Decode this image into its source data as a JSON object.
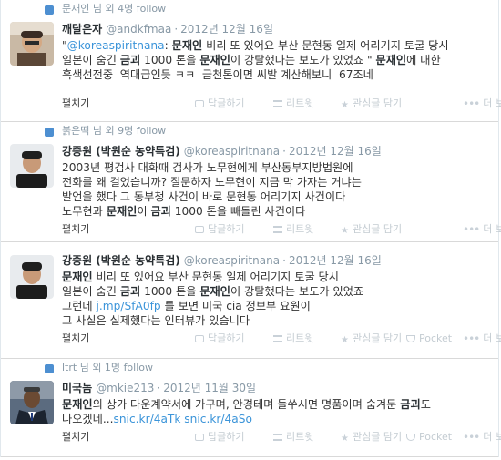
{
  "tweets": [
    {
      "context": {
        "prefix": "문재인 님 외 4명",
        "follow": "follow"
      },
      "name": "깨달은자",
      "handle": "@andkfmaa",
      "sep": "·",
      "time": "2012년 12월 16일",
      "lines": [
        [
          {
            "t": "\""
          },
          {
            "t": "@koreaspiritnana",
            "c": "mention"
          },
          {
            "t": ": "
          },
          {
            "t": "문재인",
            "b": 1
          },
          {
            "t": " 비리 또 있어요 부산 문현동 일제 어리기지 토굴 당시"
          }
        ],
        [
          {
            "t": "일본이 숨긴 "
          },
          {
            "t": "금괴",
            "b": 1
          },
          {
            "t": " 1000 톤을 "
          },
          {
            "t": "문재인",
            "b": 1
          },
          {
            "t": "이 강탈했다는 보도가 있었죠 \" "
          },
          {
            "t": "문재인",
            "b": 1
          },
          {
            "t": "에 대한"
          }
        ],
        [
          {
            "t": "흑색선전중  역대급인듯 ㅋㅋ  금천톤이면 씨발 계산해보니  67조네"
          }
        ]
      ],
      "actions": {
        "expand": "펼치기",
        "reply": "답글하기",
        "retweet": "리트윗",
        "fav": "관심글 담기",
        "pocket": "",
        "more": "더 보기"
      }
    },
    {
      "context": {
        "prefix": "붉은떡 님 외 9명",
        "follow": "follow"
      },
      "name": "강종원 (박원순 농약특검)",
      "handle": "@koreaspiritnana",
      "sep": "·",
      "time": "2012년 12월 16일",
      "lines": [
        [
          {
            "t": "2003년 평검사 대화때 검사가 노무현에게 부산동부지방법원에"
          }
        ],
        [
          {
            "t": "전화를 왜 걸었습니까? 질문하자 노무현이 지금 막 가자는 거냐는"
          }
        ],
        [
          {
            "t": "발언을 했다 그 동부청 사건이 바로 문현동 어리기지 사건이다"
          }
        ],
        [
          {
            "t": "노무현과 "
          },
          {
            "t": "문재인",
            "b": 1
          },
          {
            "t": "이 "
          },
          {
            "t": "금괴",
            "b": 1
          },
          {
            "t": " 1000 톤을 빼돌린 사건이다"
          }
        ]
      ],
      "actions": {
        "expand": "펼치기",
        "reply": "답글하기",
        "retweet": "리트윗",
        "fav": "관심글 담기",
        "pocket": "",
        "more": "더 보기"
      }
    },
    {
      "name": "강종원 (박원순 농약특검)",
      "handle": "@koreaspiritnana",
      "sep": "·",
      "time": "2012년 12월 16일",
      "lines": [
        [
          {
            "t": "문재인",
            "b": 1
          },
          {
            "t": " 비리 또 있어요 부산 문현동 일제 어리기지 토굴 당시"
          }
        ],
        [
          {
            "t": "일본이 숨긴 "
          },
          {
            "t": "금괴",
            "b": 1
          },
          {
            "t": " 1000 톤을 "
          },
          {
            "t": "문재인",
            "b": 1
          },
          {
            "t": "이 강탈했다는 보도가 있었죠"
          }
        ],
        [
          {
            "t": "그런데 "
          },
          {
            "t": "j.mp/SfA0fp",
            "c": "link"
          },
          {
            "t": " 를 보면 미국 cia 정보부 요원이"
          }
        ],
        [
          {
            "t": "그 사실은 실제했다는 인터뷰가 있습니다"
          }
        ]
      ],
      "actions": {
        "expand": "펼치기",
        "reply": "답글하기",
        "retweet": "리트윗",
        "fav": "관심글 담기",
        "pocket": "Pocket",
        "more": "더 보기"
      }
    },
    {
      "context": {
        "prefix": "ltrt 님 외 1명",
        "follow": "follow"
      },
      "name": "미국놈",
      "handle": "@mkie213",
      "sep": "·",
      "time": "2012년 11월 30일",
      "lines": [
        [
          {
            "t": "문재인",
            "b": 1
          },
          {
            "t": "의 상가 다운계약서에 가구며, 안경테며 들쑤시면 명품이며 숨겨둔 "
          },
          {
            "t": "금괴",
            "b": 1
          },
          {
            "t": "도"
          }
        ],
        [
          {
            "t": "나오겠네..."
          },
          {
            "t": "snic.kr/4aTk",
            "c": "link"
          },
          {
            "t": " "
          },
          {
            "t": "snic.kr/4aSo",
            "c": "link"
          }
        ]
      ],
      "actions": {
        "expand": "펼치기",
        "reply": "답글하기",
        "retweet": "리트윗",
        "fav": "관심글 담기",
        "pocket": "Pocket",
        "more": "더 보기"
      }
    }
  ]
}
